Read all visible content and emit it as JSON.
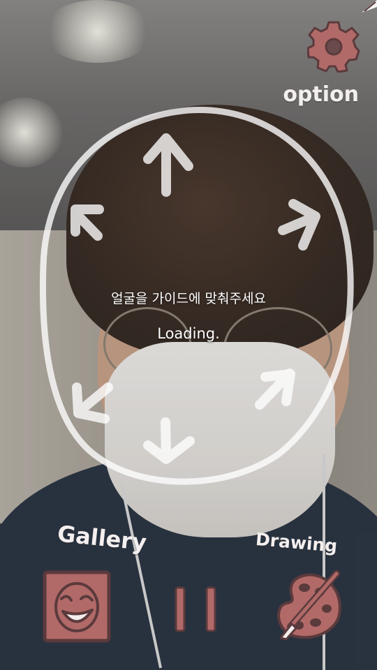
{
  "hud": {
    "guide_message": "얼굴을 가이드에 맞춰주세요",
    "loading_text": "Loading."
  },
  "buttons": {
    "option_label": "option",
    "gallery_label": "Gallery",
    "drawing_label": "Drawing"
  },
  "icons": {
    "settings": "gear-icon",
    "gallery": "smiling-face-picture-icon",
    "pause": "pause-icon",
    "drawing": "palette-brush-icon"
  },
  "colors": {
    "accent_rose": "#b16a68",
    "icon_outline": "#5b3a3c",
    "overlay_white": "#ffffff"
  }
}
